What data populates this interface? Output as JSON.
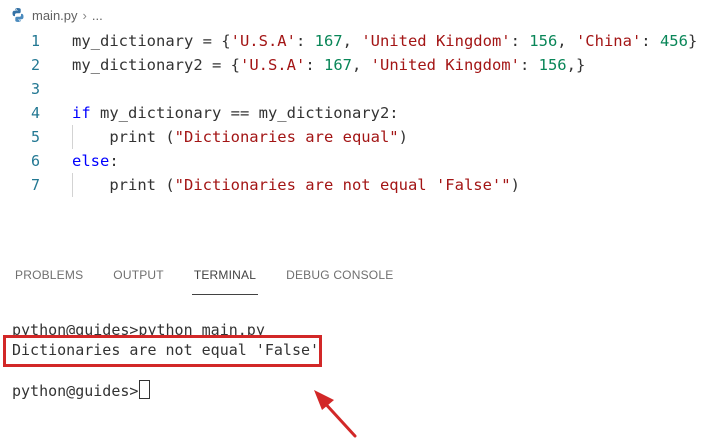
{
  "breadcrumb": {
    "file": "main.py",
    "ellipsis": "...",
    "separator": "›"
  },
  "editor": {
    "lines": [
      {
        "num": "1",
        "parts": [
          [
            "my_dictionary = {",
            ""
          ],
          [
            "'U.S.A'",
            "str"
          ],
          [
            ": ",
            ""
          ],
          [
            "167",
            "num"
          ],
          [
            ", ",
            ""
          ],
          [
            "'United Kingdom'",
            "str"
          ],
          [
            ": ",
            ""
          ],
          [
            "156",
            "num"
          ],
          [
            ", ",
            ""
          ],
          [
            "'China'",
            "str"
          ],
          [
            ": ",
            ""
          ],
          [
            "456",
            "num"
          ],
          [
            "}",
            ""
          ]
        ]
      },
      {
        "num": "2",
        "parts": [
          [
            "my_dictionary2 = {",
            ""
          ],
          [
            "'U.S.A'",
            "str"
          ],
          [
            ": ",
            ""
          ],
          [
            "167",
            "num"
          ],
          [
            ", ",
            ""
          ],
          [
            "'United Kingdom'",
            "str"
          ],
          [
            ": ",
            ""
          ],
          [
            "156",
            "num"
          ],
          [
            ",}",
            ""
          ]
        ]
      },
      {
        "num": "3",
        "parts": []
      },
      {
        "num": "4",
        "parts": [
          [
            "if",
            "kw"
          ],
          [
            " my_dictionary == my_dictionary2:",
            ""
          ]
        ]
      },
      {
        "num": "5",
        "parts": [
          [
            "    print (",
            ""
          ],
          [
            "\"Dictionaries are equal\"",
            "str"
          ],
          [
            ")",
            ""
          ]
        ]
      },
      {
        "num": "6",
        "parts": [
          [
            "else",
            "kw"
          ],
          [
            ":",
            ""
          ]
        ]
      },
      {
        "num": "7",
        "parts": [
          [
            "    print (",
            ""
          ],
          [
            "\"Dictionaries are not equal 'False'\"",
            "str"
          ],
          [
            ")",
            ""
          ]
        ]
      }
    ]
  },
  "panel": {
    "tabs": [
      {
        "label": "PROBLEMS",
        "active": false
      },
      {
        "label": "OUTPUT",
        "active": false
      },
      {
        "label": "TERMINAL",
        "active": true
      },
      {
        "label": "DEBUG CONSOLE",
        "active": false
      }
    ]
  },
  "terminal": {
    "command_line": "python@guides>python main.py",
    "output_line": "Dictionaries are not equal 'False'",
    "prompt": "python@guides>"
  },
  "colors": {
    "annotation": "#d22828"
  }
}
